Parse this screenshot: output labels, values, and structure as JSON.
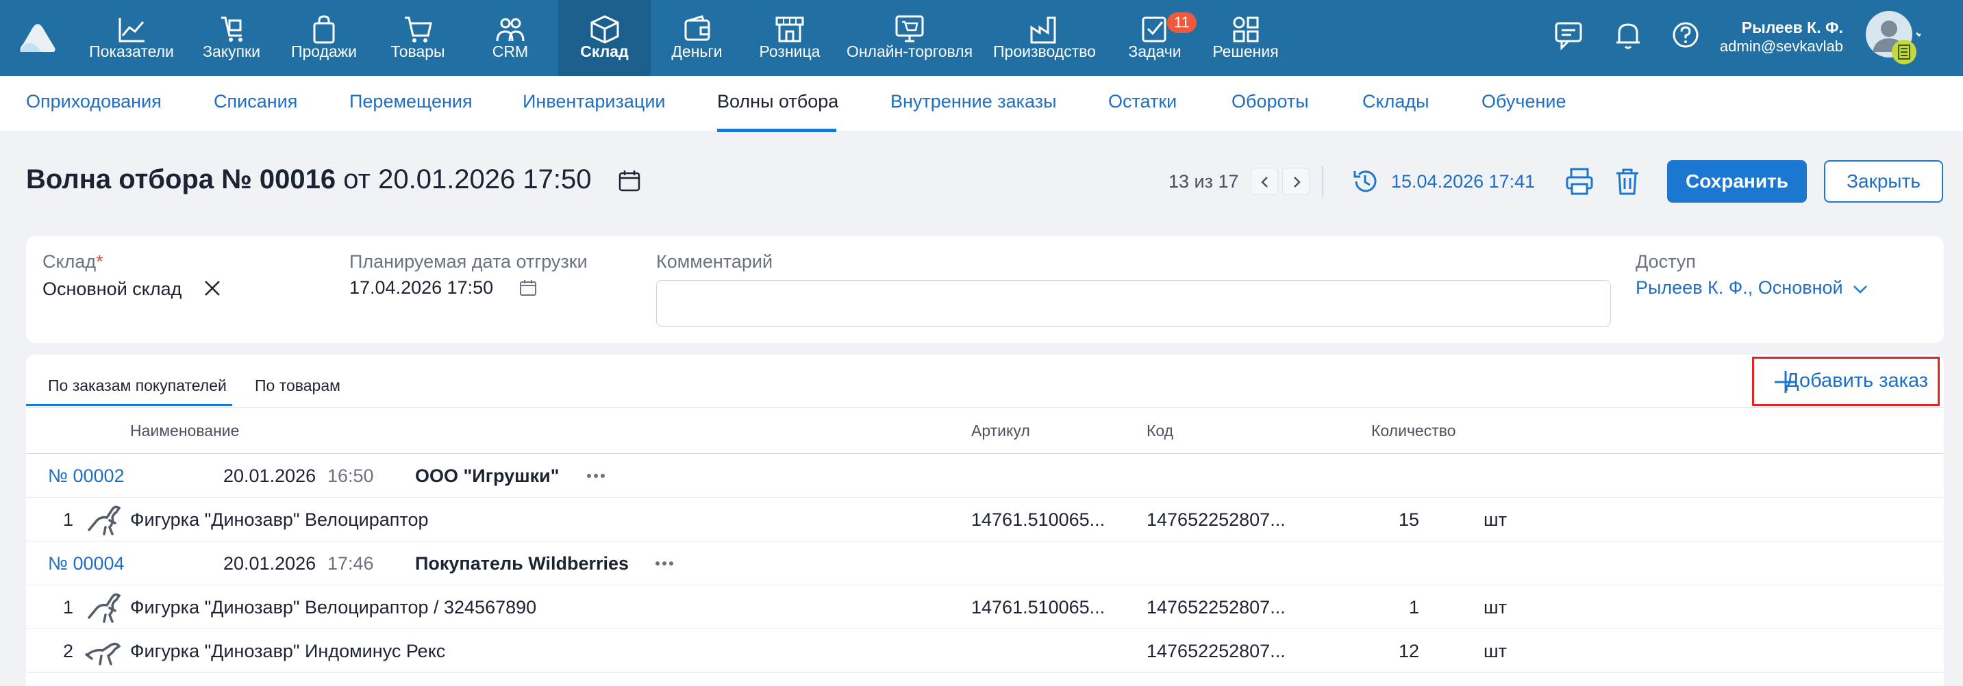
{
  "topnav": {
    "items": [
      {
        "label": "Показатели",
        "icon": "chart-icon"
      },
      {
        "label": "Закупки",
        "icon": "purchases-icon"
      },
      {
        "label": "Продажи",
        "icon": "bag-icon"
      },
      {
        "label": "Товары",
        "icon": "cart-icon"
      },
      {
        "label": "CRM",
        "icon": "people-icon"
      },
      {
        "label": "Склад",
        "icon": "box-icon"
      },
      {
        "label": "Деньги",
        "icon": "wallet-icon"
      },
      {
        "label": "Розница",
        "icon": "store-icon"
      },
      {
        "label": "Онлайн-торговля",
        "icon": "online-store-icon"
      },
      {
        "label": "Производство",
        "icon": "factory-icon"
      },
      {
        "label": "Задачи",
        "icon": "tasks-icon"
      },
      {
        "label": "Решения",
        "icon": "apps-icon"
      }
    ],
    "tasks_badge": "11",
    "active": "Склад"
  },
  "user": {
    "name": "Рылеев К. Ф.",
    "email": "admin@sevkavlab"
  },
  "subnav": {
    "tabs": [
      "Оприходования",
      "Списания",
      "Перемещения",
      "Инвентаризации",
      "Волны отбора",
      "Внутренние заказы",
      "Остатки",
      "Обороты",
      "Склады",
      "Обучение"
    ],
    "active": "Волны отбора"
  },
  "doc": {
    "title": "Волна отбора № 00016",
    "from": "от",
    "date": "20.01.2026 17:50",
    "pager": "13 из 17",
    "history_date": "15.04.2026 17:41",
    "save_label": "Сохранить",
    "close_label": "Закрыть"
  },
  "form": {
    "warehouse_label": "Склад",
    "warehouse_required": "*",
    "warehouse_value": "Основной склад",
    "ship_label": "Планируемая дата отгрузки",
    "ship_value": "17.04.2026 17:50",
    "comment_label": "Комментарий",
    "comment_value": "",
    "access_label": "Доступ",
    "access_value": "Рылеев К. Ф., Основной"
  },
  "orders_section": {
    "tabs": [
      "По заказам покупателей",
      "По товарам"
    ],
    "active_tab": "По заказам покупателей",
    "add_label": "Добавить заказ",
    "columns": {
      "name": "Наименование",
      "article": "Артикул",
      "code": "Код",
      "qty": "Количество"
    },
    "orders": [
      {
        "number": "№ 00002",
        "date": "20.01.2026",
        "time": "16:50",
        "customer": "ООО \"Игрушки\"",
        "items": [
          {
            "idx": "1",
            "name": "Фигурка \"Динозавр\" Велоцираптор",
            "article": "14761.510065...",
            "code": "147652252807...",
            "qty": "15",
            "unit": "шт"
          }
        ]
      },
      {
        "number": "№ 00004",
        "date": "20.01.2026",
        "time": "17:46",
        "customer": "Покупатель Wildberries",
        "items": [
          {
            "idx": "1",
            "name": "Фигурка \"Динозавр\" Велоцираптор / 324567890",
            "article": "14761.510065...",
            "code": "147652252807...",
            "qty": "1",
            "unit": "шт"
          },
          {
            "idx": "2",
            "name": "Фигурка \"Динозавр\" Индоминус Рекс",
            "article": "",
            "code": "147652252807...",
            "qty": "12",
            "unit": "шт"
          }
        ]
      }
    ]
  }
}
